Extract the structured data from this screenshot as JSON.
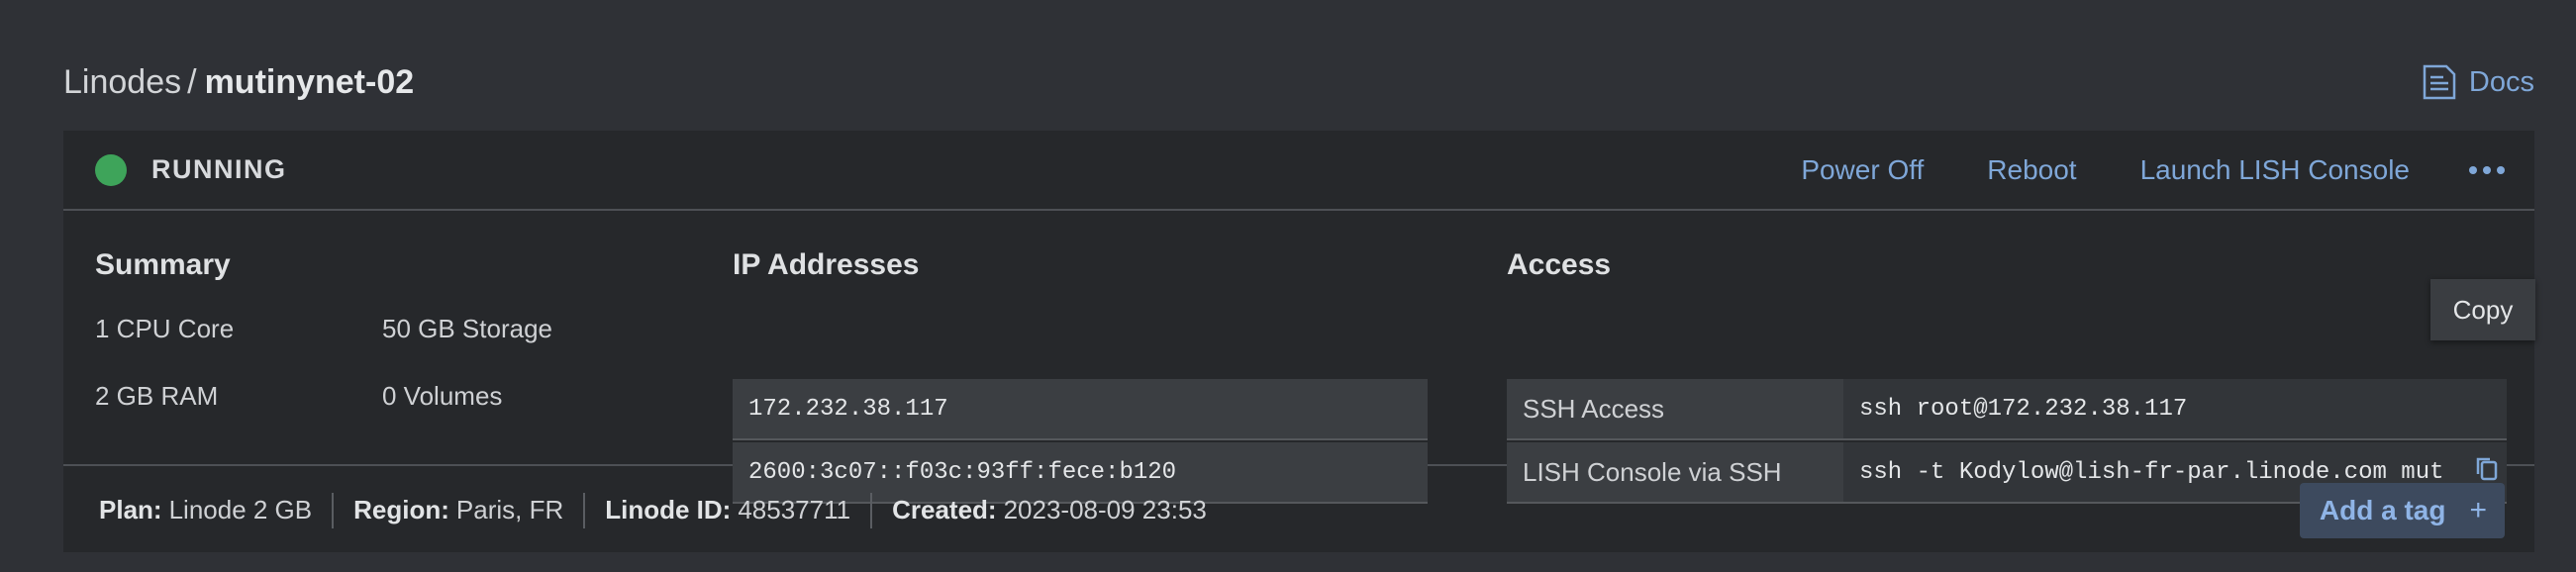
{
  "breadcrumb": {
    "parent": "Linodes",
    "separator": "/",
    "current": "mutinynet-02"
  },
  "header": {
    "docs_label": "Docs"
  },
  "status": {
    "label": "RUNNING",
    "color": "#3ea45a"
  },
  "actions": {
    "power_off": "Power Off",
    "reboot": "Reboot",
    "launch_lish": "Launch LISH Console"
  },
  "summary": {
    "title": "Summary",
    "cpu": "1 CPU Core",
    "storage": "50 GB Storage",
    "ram": "2 GB RAM",
    "volumes": "0 Volumes"
  },
  "ip_addresses": {
    "title": "IP Addresses",
    "items": [
      "172.232.38.117",
      "2600:3c07::f03c:93ff:fece:b120"
    ]
  },
  "access": {
    "title": "Access",
    "rows": [
      {
        "label": "SSH Access",
        "value": "ssh root@172.232.38.117"
      },
      {
        "label": "LISH Console via SSH",
        "value": "ssh -t Kodylow@lish-fr-par.linode.com mut"
      }
    ]
  },
  "tooltip": {
    "text": "Copy"
  },
  "footer": {
    "plan_label": "Plan:",
    "plan_value": "Linode 2 GB",
    "region_label": "Region:",
    "region_value": "Paris, FR",
    "id_label": "Linode ID:",
    "id_value": "48537711",
    "created_label": "Created:",
    "created_value": "2023-08-09 23:53",
    "add_tag_label": "Add a tag",
    "add_tag_icon": "+"
  },
  "colors": {
    "accent": "#7fa7d8",
    "running": "#3ea45a",
    "background": "#2f3136",
    "panel": "#26282b"
  }
}
